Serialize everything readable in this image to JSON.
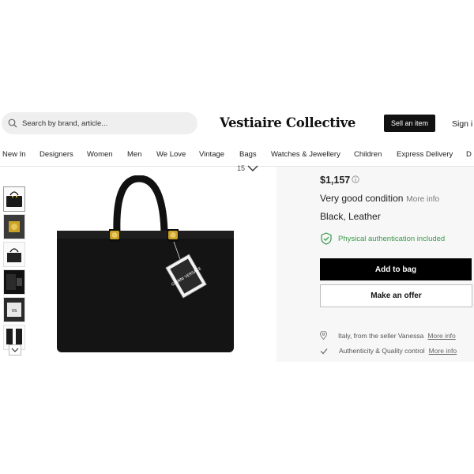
{
  "header": {
    "search_placeholder": "Search by brand, article...",
    "logo": "Vestiaire Collective",
    "sell_label": "Sell an item",
    "signin_label": "Sign i"
  },
  "nav": {
    "items": [
      "New In",
      "Designers",
      "Women",
      "Men",
      "We Love",
      "Vintage",
      "Bags",
      "Watches & Jewellery",
      "Children",
      "Express Delivery",
      "D"
    ]
  },
  "gallery": {
    "counter": "15",
    "thumb_count": 6,
    "tag_text": "GIANNI VERSACE"
  },
  "product": {
    "price": "$1,157",
    "condition": "Very good condition",
    "condition_more": "More info",
    "material": "Black, Leather",
    "authentication": "Physical authentication included",
    "add_to_bag": "Add to bag",
    "make_offer": "Make an offer",
    "seller_location": "Italy, from the seller Vanessa",
    "seller_more": "More info",
    "quality": "Authenticity & Quality control",
    "quality_more": "More info"
  },
  "colors": {
    "accent": "#000000",
    "auth_green": "#3a9a4a",
    "panel_bg": "#f7f7f7"
  }
}
